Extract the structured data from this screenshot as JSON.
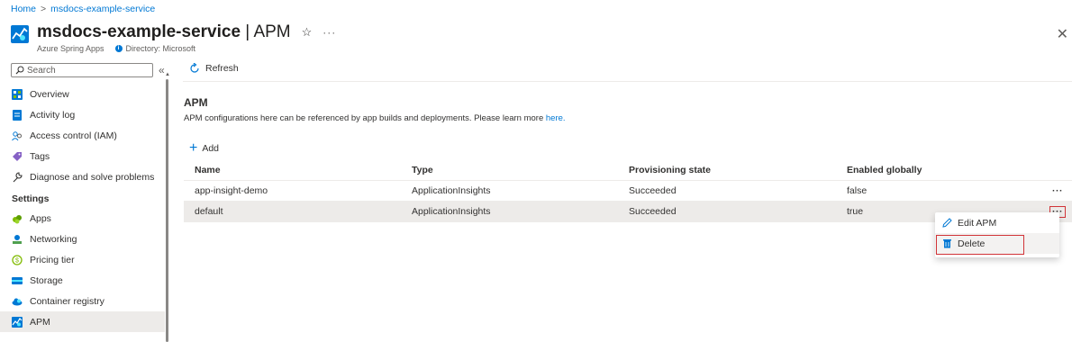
{
  "breadcrumb": {
    "home": "Home",
    "separator": ">",
    "current": "msdocs-example-service"
  },
  "header": {
    "title_bold": "msdocs-example-service",
    "title_rest": " | APM",
    "subtitle_service": "Azure Spring Apps",
    "subtitle_directory": "Directory: Microsoft"
  },
  "sidebar": {
    "search_placeholder": "Search",
    "collapse": "«",
    "items": [
      {
        "label": "Overview",
        "icon": "overview-icon"
      },
      {
        "label": "Activity log",
        "icon": "activity-log-icon"
      },
      {
        "label": "Access control (IAM)",
        "icon": "people-icon"
      },
      {
        "label": "Tags",
        "icon": "tag-icon"
      },
      {
        "label": "Diagnose and solve problems",
        "icon": "wrench-icon"
      }
    ],
    "settings_heading": "Settings",
    "settings_items": [
      {
        "label": "Apps",
        "icon": "apps-icon"
      },
      {
        "label": "Networking",
        "icon": "networking-icon"
      },
      {
        "label": "Pricing tier",
        "icon": "pricing-icon"
      },
      {
        "label": "Storage",
        "icon": "storage-icon"
      },
      {
        "label": "Container registry",
        "icon": "cloud-icon"
      },
      {
        "label": "APM",
        "icon": "apm-icon",
        "active": true
      }
    ]
  },
  "toolbar": {
    "refresh_label": "Refresh"
  },
  "main": {
    "heading": "APM",
    "description": "APM configurations here can be referenced by app builds and deployments. Please learn more ",
    "learn_more_link": "here.",
    "add_label": "Add"
  },
  "table": {
    "columns": [
      "Name",
      "Type",
      "Provisioning state",
      "Enabled globally"
    ],
    "rows": [
      {
        "name": "app-insight-demo",
        "type": "ApplicationInsights",
        "state": "Succeeded",
        "enabled": "false",
        "more": "···"
      },
      {
        "name": "default",
        "type": "ApplicationInsights",
        "state": "Succeeded",
        "enabled": "true",
        "more": "···",
        "selected": true
      }
    ]
  },
  "context_menu": {
    "edit_label": "Edit APM",
    "delete_label": "Delete"
  },
  "colors": {
    "accent": "#0078d4",
    "highlight_border": "#d13438",
    "selected_row": "#edebe9"
  }
}
